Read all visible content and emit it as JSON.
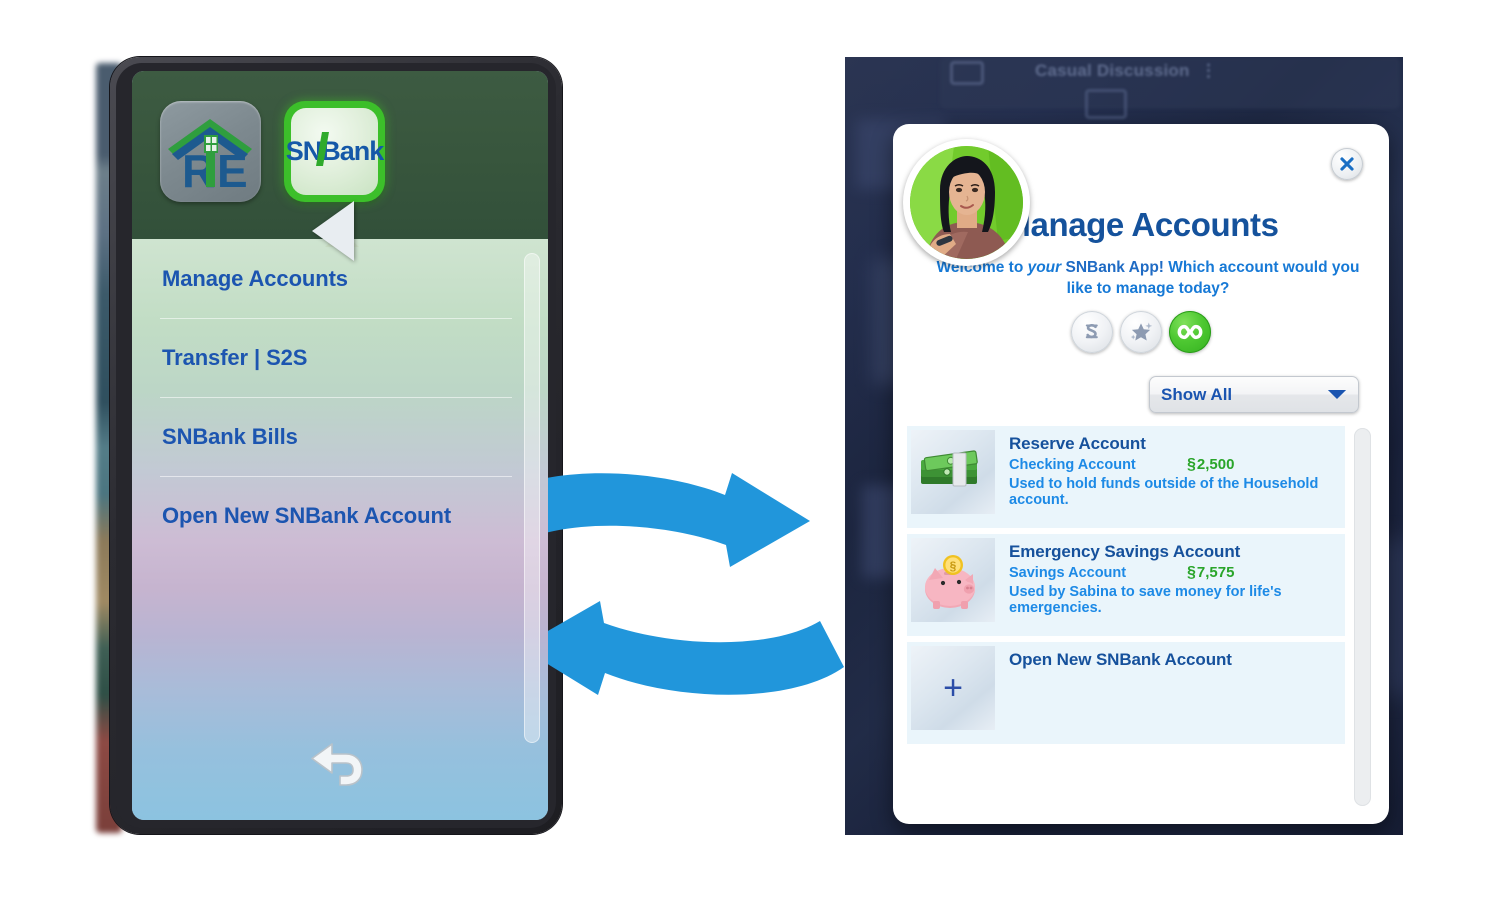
{
  "phone": {
    "apps": [
      {
        "name": "RE",
        "icon": "real-estate-house-icon"
      },
      {
        "name": "SNBank",
        "icon": "snbank-app-icon",
        "selected": true
      }
    ],
    "snbank_logo": {
      "part_sn": "SN",
      "part_b": "B",
      "part_ank": "ank"
    },
    "menu_items": [
      {
        "label": "Manage Accounts"
      },
      {
        "label": "Transfer | S2S"
      },
      {
        "label": "SNBank Bills"
      },
      {
        "label": "Open New SNBank Account"
      }
    ],
    "back_button_icon": "back-arrow-icon",
    "accent_text_color": "#1c55b0"
  },
  "arrows": {
    "color": "#2196db",
    "top_arrow_icon": "arrow-right-icon",
    "bottom_arrow_icon": "arrow-left-icon"
  },
  "game": {
    "background_label": "Casual Discussion",
    "dialog": {
      "title": "Manage Accounts",
      "subtitle_part1": "Welcome to ",
      "subtitle_italic": "your",
      "subtitle_bold": " SNBank App!",
      "subtitle_part2": " Which account would you like to manage today?",
      "close_icon": "close-icon",
      "avatar_name": "sim-avatar",
      "title_color": "#15529c",
      "subtitle_color": "#1679d6",
      "filters": [
        {
          "icon": "simoleon-icon",
          "active": false
        },
        {
          "icon": "star-sparkle-icon",
          "active": false
        },
        {
          "icon": "infinity-icon",
          "active": true
        }
      ],
      "dropdown": {
        "value": "Show All",
        "chevron_icon": "chevron-down-icon"
      },
      "accounts": [
        {
          "name": "Reserve Account",
          "type": "Checking Account",
          "amount_symbol": "§",
          "amount": "2,500",
          "description": "Used to hold funds outside of the Household account.",
          "icon": "money-stack-icon"
        },
        {
          "name": "Emergency Savings Account",
          "type": "Savings Account",
          "amount_symbol": "§",
          "amount": "7,575",
          "description": "Used by Sabina to save money for life's emergencies.",
          "icon": "piggy-bank-icon"
        },
        {
          "name": "Open New SNBank Account",
          "type": "",
          "amount_symbol": "",
          "amount": "",
          "description": "",
          "icon": "plus-icon"
        }
      ]
    }
  }
}
